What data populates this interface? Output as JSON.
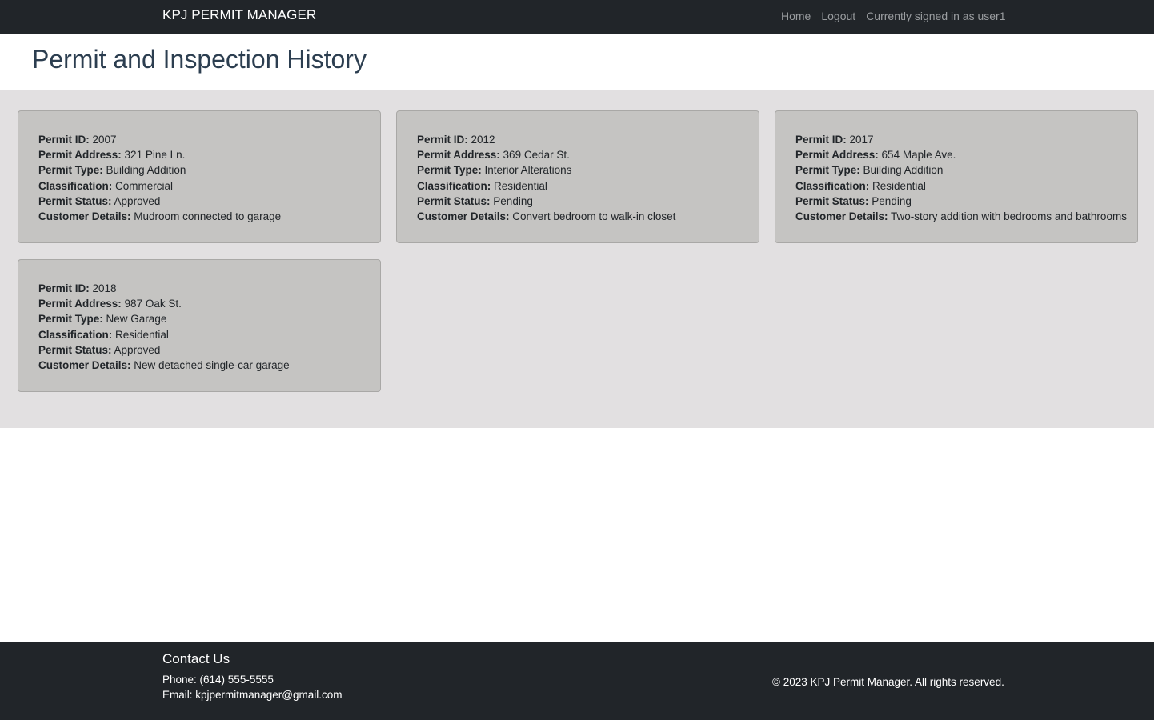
{
  "navbar": {
    "brand": "KPJ PERMIT MANAGER",
    "home": "Home",
    "logout": "Logout",
    "signed_in": "Currently signed in as user1"
  },
  "page": {
    "title": "Permit and Inspection History"
  },
  "labels": {
    "permit_id": "Permit ID:",
    "permit_address": "Permit Address:",
    "permit_type": "Permit Type:",
    "classification": "Classification:",
    "permit_status": "Permit Status:",
    "customer_details": "Customer Details:"
  },
  "permits": [
    {
      "id": "2007",
      "address": "321 Pine Ln.",
      "type": "Building Addition",
      "classification": "Commercial",
      "status": "Approved",
      "details": "Mudroom connected to garage"
    },
    {
      "id": "2012",
      "address": "369 Cedar St.",
      "type": "Interior Alterations",
      "classification": "Residential",
      "status": "Pending",
      "details": "Convert bedroom to walk-in closet"
    },
    {
      "id": "2017",
      "address": "654 Maple Ave.",
      "type": "Building Addition",
      "classification": "Residential",
      "status": "Pending",
      "details": "Two-story addition with bedrooms and bathrooms"
    },
    {
      "id": "2018",
      "address": "987 Oak St.",
      "type": "New Garage",
      "classification": "Residential",
      "status": "Approved",
      "details": "New detached single-car garage"
    }
  ],
  "footer": {
    "heading": "Contact Us",
    "phone": "Phone: (614) 555-5555",
    "email": "Email: kpjpermitmanager@gmail.com",
    "copyright": "© 2023 KPJ Permit Manager. All rights reserved."
  }
}
